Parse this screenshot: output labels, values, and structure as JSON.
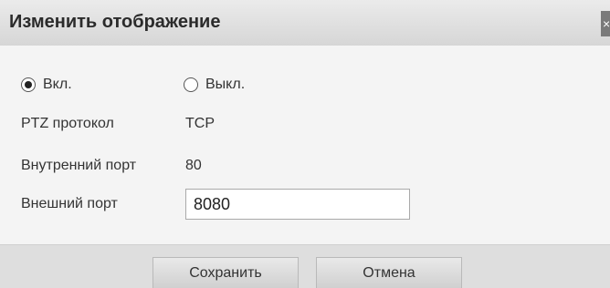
{
  "dialog": {
    "title": "Изменить отображение",
    "close_label": "×"
  },
  "mode": {
    "on_label": "Вкл.",
    "off_label": "Выкл.",
    "selected": "on"
  },
  "fields": {
    "ptz_label": "PTZ протокол",
    "ptz_value": "TCP",
    "internal_port_label": "Внутренний порт",
    "internal_port_value": "80",
    "external_port_label": "Внешний порт",
    "external_port_value": "8080"
  },
  "buttons": {
    "save_label": "Сохранить",
    "cancel_label": "Отмена"
  }
}
